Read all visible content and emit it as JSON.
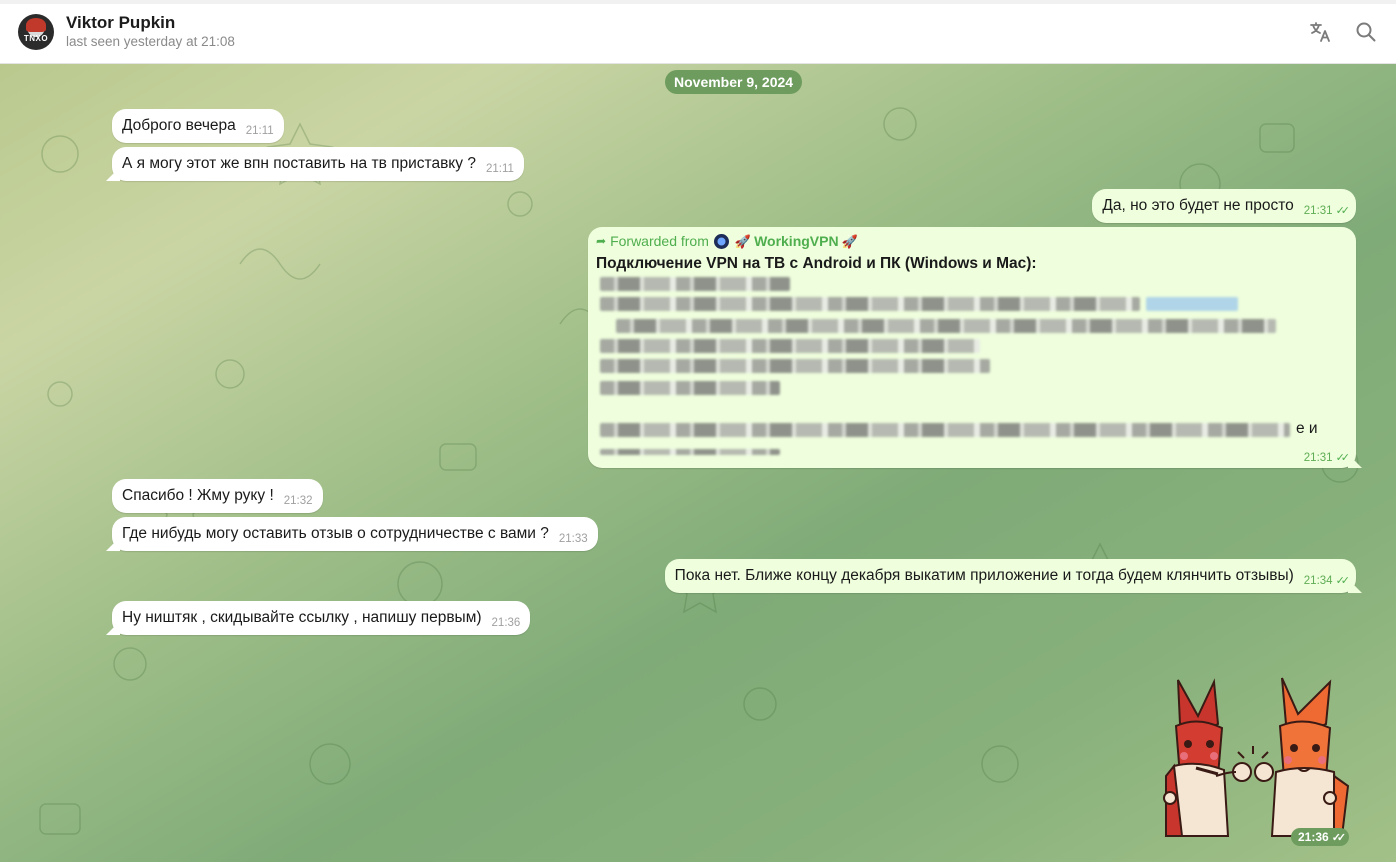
{
  "header": {
    "avatar_text": "TNXO",
    "peer_name": "Viktor Pupkin",
    "peer_status": "last seen yesterday at 21:08"
  },
  "date_separator": "November 9, 2024",
  "messages": [
    {
      "text": "Доброго вечера",
      "time": "21:11",
      "direction": "in"
    },
    {
      "text": "А я могу этот же впн поставить на тв приставку ?",
      "time": "21:11",
      "direction": "in"
    },
    {
      "text": "Да, но это будет не просто",
      "time": "21:31",
      "direction": "out"
    },
    {
      "text": "Спасибо ! Жму руку !",
      "time": "21:32",
      "direction": "in"
    },
    {
      "text": "Где нибудь могу оставить отзыв о сотрудничестве с вами ?",
      "time": "21:33",
      "direction": "in"
    },
    {
      "text": "Пока нет. Ближе концу декабря выкатим приложение и тогда будем клянчить отзывы)",
      "time": "21:34",
      "direction": "out"
    },
    {
      "text": "Ну ништяк , скидывайте ссылку , напишу первым)",
      "time": "21:36",
      "direction": "in"
    }
  ],
  "forwarded": {
    "label": "Forwarded from",
    "channel": "WorkingVPN",
    "title": "Подключение VPN на ТВ с Android и ПК (Windows и Mac):",
    "trailing_text": "e и",
    "time": "21:31"
  },
  "sticker": {
    "time": "21:36"
  },
  "icons": [
    "translate-icon",
    "search-icon",
    "double-check-icon",
    "forward-arrow-icon",
    "rocket-icon"
  ],
  "colors": {
    "outgoing": "#effedd",
    "incoming": "#ffffff",
    "accent": "#4fae4e",
    "pill": "#6d9c5e"
  }
}
